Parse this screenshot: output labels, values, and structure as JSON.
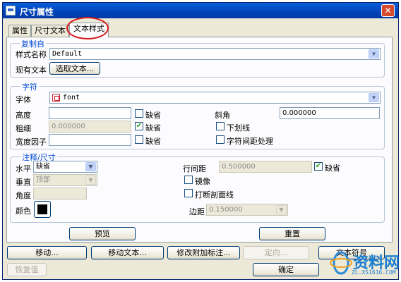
{
  "window": {
    "title": "尺寸属性",
    "close_glyph": "✕"
  },
  "tabs": [
    {
      "label": "属性",
      "active": false
    },
    {
      "label": "尺寸文本",
      "active": false
    },
    {
      "label": "文本样式",
      "active": true
    }
  ],
  "copy_from": {
    "legend": "复制自",
    "style_name_label": "样式名称",
    "style_name_value": "Default",
    "existing_text_label": "现有文本",
    "select_text_button": "选取文本..."
  },
  "character": {
    "legend": "字符",
    "font_label": "字体",
    "font_value": "font",
    "height_label": "高度",
    "height_value": "",
    "height_default_label": "缺省",
    "height_default_checked": false,
    "slant_label": "斜角",
    "slant_value": "0.000000",
    "thickness_label": "粗细",
    "thickness_value": "0.000000",
    "thickness_default_label": "缺省",
    "thickness_default_checked": true,
    "underline_label": "下划线",
    "underline_checked": false,
    "width_factor_label": "宽度因子",
    "width_factor_value": "",
    "width_default_label": "缺省",
    "width_default_checked": false,
    "kerning_label": "字符间距处理",
    "kerning_checked": false
  },
  "note_dimension": {
    "legend": "注释/尺寸",
    "horizontal_label": "水平",
    "horizontal_value": "缺省",
    "vertical_label": "垂直",
    "vertical_value": "顶部",
    "angle_label": "角度",
    "angle_value": "",
    "color_label": "颜色",
    "color_value": "#000000",
    "line_spacing_label": "行间距",
    "line_spacing_value": "0.500000",
    "line_spacing_default_label": "缺省",
    "line_spacing_default_checked": true,
    "mirror_label": "镜像",
    "mirror_checked": false,
    "break_hatch_label": "打断剖面线",
    "break_hatch_checked": false,
    "margin_label": "边距",
    "margin_value": "0.150000"
  },
  "panel_buttons": {
    "preview": "预览",
    "reset": "重置"
  },
  "bottom_buttons": {
    "move": "移动...",
    "move_text": "移动文本...",
    "modify_attach": "修改附加标注...",
    "orient": "定向...",
    "text_symbol": "文本符号",
    "restore": "恢复值",
    "ok": "确定"
  },
  "watermark": {
    "brand": "资料网",
    "url": "ZL.XS1616.COM"
  },
  "icons": {
    "app": "window-app-icon",
    "close": "close-icon",
    "dropdown": "chevron-down-icon",
    "font": "font-icon",
    "check": "checkmark-icon"
  }
}
